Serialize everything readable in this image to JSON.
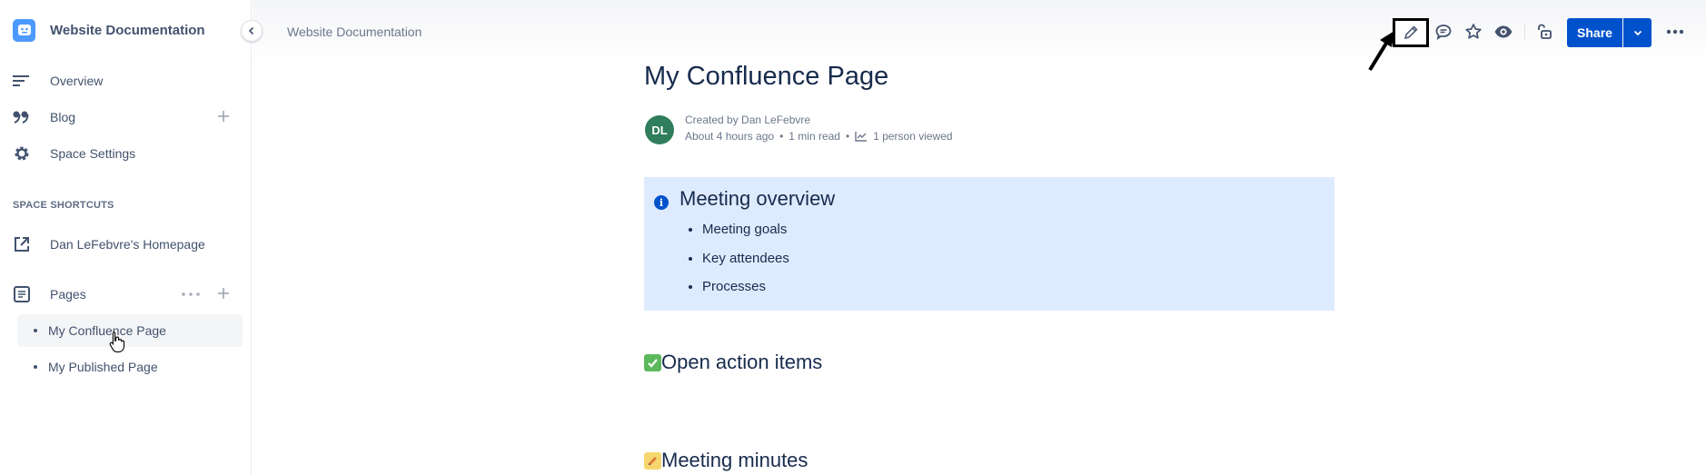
{
  "sidebar": {
    "space_title": "Website Documentation",
    "nav": [
      {
        "label": "Overview",
        "icon": "overview-lines-icon"
      },
      {
        "label": "Blog",
        "icon": "quote-icon"
      },
      {
        "label": "Space Settings",
        "icon": "gear-icon"
      }
    ],
    "shortcuts_heading": "SPACE SHORTCUTS",
    "shortcut": {
      "label": "Dan LeFebvre's Homepage",
      "icon": "external-link-icon"
    },
    "pages_label": "Pages",
    "pages": [
      {
        "label": "My Confluence Page",
        "active": true
      },
      {
        "label": "My Published Page",
        "active": false
      }
    ]
  },
  "topbar": {
    "breadcrumb": "Website Documentation",
    "share_label": "Share",
    "icons": [
      "edit-pencil-icon",
      "comment-icon",
      "star-icon",
      "watch-eye-icon",
      "restrictions-lock-icon",
      "more-icon"
    ]
  },
  "page": {
    "title": "My Confluence Page",
    "author_initials": "DL",
    "created_by": "Created by Dan LeFebvre",
    "time_ago": "About 4 hours ago",
    "read_time": "1 min read",
    "views": "1 person viewed",
    "info_panel": {
      "title": "Meeting overview",
      "items": [
        "Meeting goals",
        "Key attendees",
        "Processes"
      ]
    },
    "section_action": "Open action items",
    "section_minutes": "Meeting minutes"
  },
  "colors": {
    "accent": "#0052cc",
    "panel_bg": "#deebff",
    "avatar": "#2f7d5b",
    "check_emoji": "#5cb85c",
    "memo_emoji": "#f5d76e"
  }
}
